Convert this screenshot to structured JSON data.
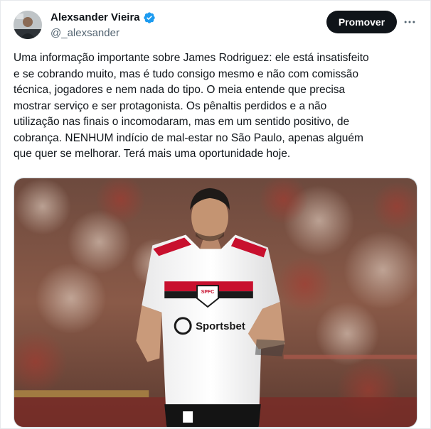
{
  "author": {
    "display_name": "Alexsander Vieira",
    "handle": "@_alexsander",
    "verified": true,
    "avatar_icon": "profile-avatar"
  },
  "actions": {
    "promote_label": "Promover",
    "more_icon": "more-horizontal-icon"
  },
  "tweet": {
    "text": "Uma informação importante sobre James Rodriguez: ele está insatisfeito\ne se cobrando muito, mas é tudo consigo mesmo e não com comissão\ntécnica, jogadores e nem nada do tipo. O meia entende que precisa\nmostrar serviço e ser protagonista. Os pênaltis perdidos e a não\nutilização nas finais o incomodaram, mas em um sentido positivo, de\ncobrança. NENHUM indício de mal-estar no São Paulo, apenas alguém\nque quer se melhorar. Terá mais uma oportunidade hoje."
  },
  "media": {
    "jersey_sponsor": "Sportsbet",
    "crest_text": "SPFC"
  },
  "colors": {
    "verified_blue": "#1d9bf0",
    "promote_bg": "#0f1419",
    "handle_gray": "#536471",
    "jersey_red": "#c8102e"
  }
}
